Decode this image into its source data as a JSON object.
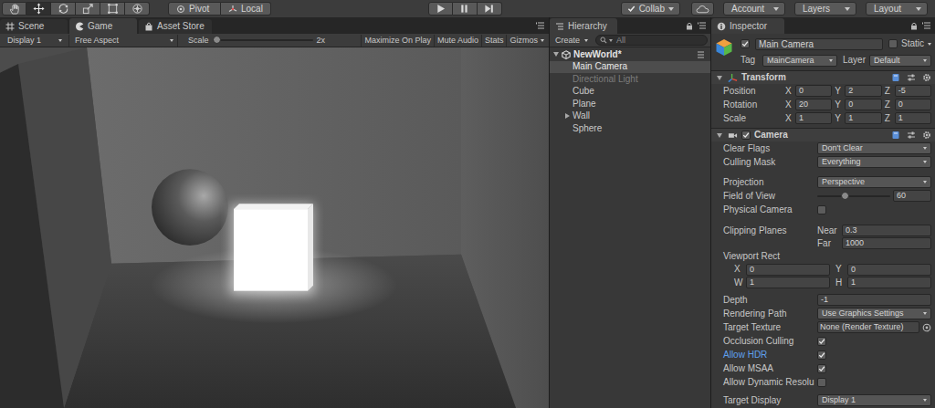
{
  "toolbar": {
    "tools": [
      {
        "kind": "hand",
        "selected": false
      },
      {
        "kind": "move",
        "selected": true
      },
      {
        "kind": "rotate",
        "selected": false
      },
      {
        "kind": "scale",
        "selected": false
      },
      {
        "kind": "rect",
        "selected": false
      },
      {
        "kind": "transform",
        "selected": false
      }
    ],
    "pivot": "Pivot",
    "local": "Local",
    "playback": [
      {
        "kind": "play"
      },
      {
        "kind": "pause"
      },
      {
        "kind": "step"
      }
    ],
    "collab": {
      "label": "Collab",
      "checked": true
    },
    "account": "Account",
    "layers": "Layers",
    "layout": "Layout"
  },
  "game": {
    "tabs": [
      {
        "label": "Scene",
        "kind": "scene",
        "selected": false
      },
      {
        "label": "Game",
        "kind": "game",
        "selected": true
      },
      {
        "label": "Asset Store",
        "kind": "store",
        "selected": false
      }
    ],
    "display": "Display 1",
    "aspect": "Free Aspect",
    "scale": {
      "label": "Scale",
      "level": 0,
      "reading": "2x"
    },
    "toggles": [
      {
        "label": "Maximize On Play",
        "on": false
      },
      {
        "label": "Mute Audio",
        "on": false
      },
      {
        "label": "Stats",
        "on": false
      }
    ],
    "gizmos": "Gizmos"
  },
  "hierarchy": {
    "tab": "Hierarchy",
    "create": "Create",
    "search": {
      "placeholder": "All"
    },
    "scene": {
      "name": "NewWorld*",
      "expanded": true
    },
    "items": [
      {
        "name": "Main Camera",
        "selected": true,
        "disabled": false,
        "has_children": false,
        "expanded": false
      },
      {
        "name": "Directional Light",
        "selected": false,
        "disabled": true,
        "has_children": false,
        "expanded": false
      },
      {
        "name": "Cube",
        "selected": false,
        "disabled": false,
        "has_children": false,
        "expanded": false
      },
      {
        "name": "Plane",
        "selected": false,
        "disabled": false,
        "has_children": false,
        "expanded": false
      },
      {
        "name": "Wall",
        "selected": false,
        "disabled": false,
        "has_children": true,
        "expanded": false
      },
      {
        "name": "Sphere",
        "selected": false,
        "disabled": false,
        "has_children": false,
        "expanded": false
      }
    ]
  },
  "inspector": {
    "tab": "Inspector",
    "object": {
      "active": true,
      "name": "Main Camera",
      "static": {
        "label": "Static",
        "checked": false
      },
      "tag": {
        "label": "Tag",
        "value": "MainCamera"
      },
      "layer": {
        "label": "Layer",
        "value": "Default"
      }
    },
    "transform": {
      "title": "Transform",
      "expanded": true,
      "rows": [
        {
          "label": "Position",
          "axes": [
            {
              "axis": "X",
              "value": "0"
            },
            {
              "axis": "Y",
              "value": "2"
            },
            {
              "axis": "Z",
              "value": "-5"
            }
          ]
        },
        {
          "label": "Rotation",
          "axes": [
            {
              "axis": "X",
              "value": "20"
            },
            {
              "axis": "Y",
              "value": "0"
            },
            {
              "axis": "Z",
              "value": "0"
            }
          ]
        },
        {
          "label": "Scale",
          "axes": [
            {
              "axis": "X",
              "value": "1"
            },
            {
              "axis": "Y",
              "value": "1"
            },
            {
              "axis": "Z",
              "value": "1"
            }
          ]
        }
      ]
    },
    "camera": {
      "title": "Camera",
      "enabled": true,
      "expanded": true,
      "properties": [
        {
          "kind": "dropdown",
          "label": "Clear Flags",
          "value": "Don't Clear",
          "modified": false
        },
        {
          "kind": "dropdown",
          "label": "Culling Mask",
          "value": "Everything",
          "modified": false
        },
        {
          "kind": "dropdown",
          "label": "Projection",
          "value": "Perspective",
          "modified": false
        },
        {
          "kind": "slider",
          "label": "Field of View",
          "value": "60",
          "level": 0.33,
          "modified": false
        },
        {
          "kind": "checkbox",
          "label": "Physical Camera",
          "checked": false,
          "modified": false
        },
        {
          "kind": "clip",
          "label": "Clipping Planes",
          "fields": [
            {
              "label": "Near",
              "value": "0.3"
            },
            {
              "label": "Far",
              "value": "1000"
            }
          ],
          "modified": false
        },
        {
          "kind": "rect",
          "label": "Viewport Rect",
          "rows": [
            [
              {
                "label": "X",
                "value": "0"
              },
              {
                "label": "Y",
                "value": "0"
              }
            ],
            [
              {
                "label": "W",
                "value": "1"
              },
              {
                "label": "H",
                "value": "1"
              }
            ]
          ],
          "modified": false
        },
        {
          "kind": "field",
          "label": "Depth",
          "value": "-1",
          "modified": false
        },
        {
          "kind": "dropdown",
          "label": "Rendering Path",
          "value": "Use Graphics Settings",
          "modified": false
        },
        {
          "kind": "object",
          "label": "Target Texture",
          "value": "None (Render Texture)",
          "modified": false
        },
        {
          "kind": "checkbox",
          "label": "Occlusion Culling",
          "checked": true,
          "modified": false
        },
        {
          "kind": "checkbox",
          "label": "Allow HDR",
          "checked": true,
          "modified": true
        },
        {
          "kind": "checkbox",
          "label": "Allow MSAA",
          "checked": true,
          "modified": false
        },
        {
          "kind": "checkbox",
          "label": "Allow Dynamic Resolu",
          "checked": false,
          "modified": false
        },
        {
          "kind": "dropdown",
          "label": "Target Display",
          "value": "Display 1",
          "modified": false
        }
      ]
    }
  }
}
